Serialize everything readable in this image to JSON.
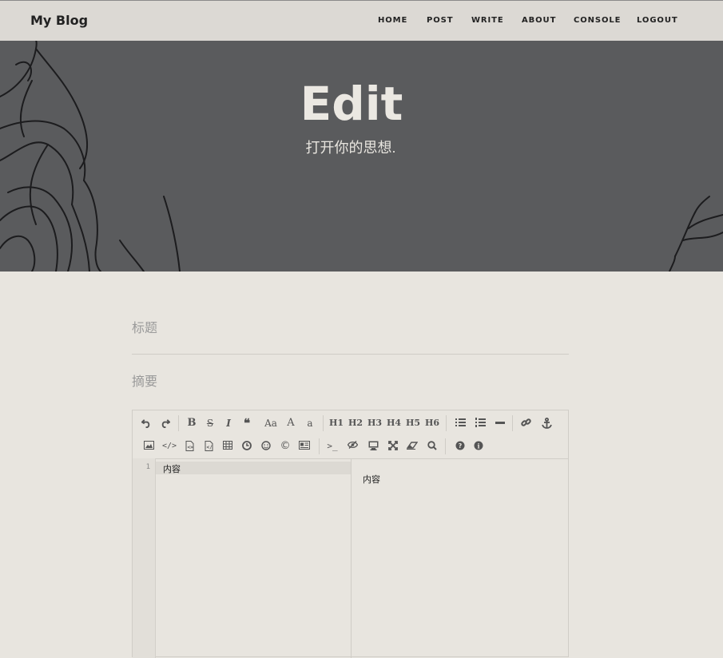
{
  "navbar": {
    "brand": "My Blog",
    "links": [
      "HOME",
      "POST",
      "WRITE",
      "ABOUT",
      "CONSOLE",
      "LOGOUT"
    ]
  },
  "hero": {
    "title": "Edit",
    "subtitle": "打开你的思想."
  },
  "form": {
    "title_placeholder": "标题",
    "summary_placeholder": "摘要"
  },
  "editor": {
    "toolbar_row1": [
      "undo-icon",
      "redo-icon",
      "|",
      "bold",
      "strikethrough",
      "italic",
      "quote-icon",
      "uppercase-first",
      "uppercase",
      "lowercase",
      "|",
      "h1",
      "h2",
      "h3",
      "h4",
      "h5",
      "h6",
      "|",
      "unordered-list-icon",
      "ordered-list-icon",
      "horizontal-rule-icon",
      "|",
      "link-icon",
      "anchor-icon"
    ],
    "toolbar_labels": {
      "bold": "B",
      "strikethrough": "S",
      "italic": "I",
      "uppercase_first": "Aa",
      "uppercase": "A",
      "lowercase": "a",
      "h1": "H1",
      "h2": "H2",
      "h3": "H3",
      "h4": "H4",
      "h5": "H5",
      "h6": "H6"
    },
    "toolbar_row2": [
      "image-icon",
      "code-icon",
      "preformatted-code-icon",
      "code-block-icon",
      "table-icon",
      "datetime-icon",
      "emoji-icon",
      "html-entities-icon",
      "pagebreak-icon",
      "|",
      "goto-line-icon",
      "watch-icon",
      "preview-icon",
      "fullscreen-icon",
      "clear-icon",
      "search-icon",
      "|",
      "help-icon",
      "info-icon"
    ],
    "line_number": "1",
    "content": "内容",
    "preview_content": "内容"
  },
  "colors": {
    "background": "#e8e5df",
    "navbar": "#dcd9d4",
    "hero": "#5a5b5d"
  }
}
